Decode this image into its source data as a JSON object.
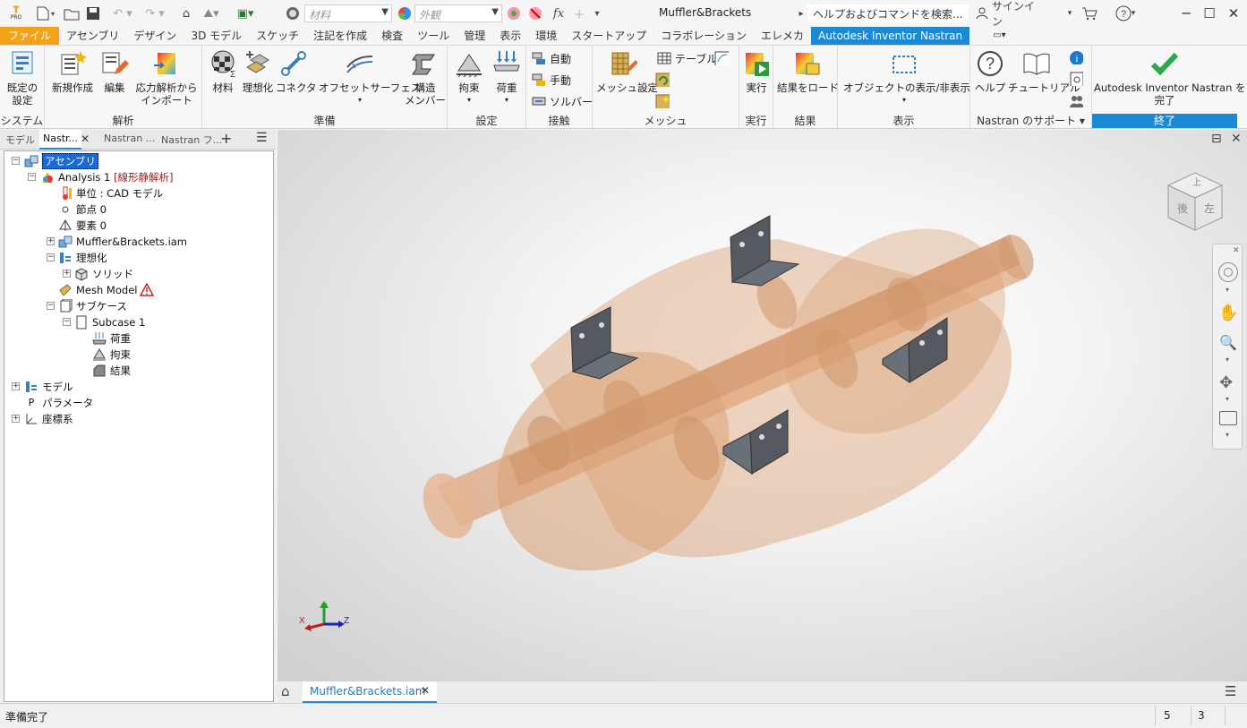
{
  "app": {
    "title": "Muffler&Brackets",
    "logo_text": "PRO"
  },
  "quick_access": {
    "material_placeholder": "材料",
    "appearance_placeholder": "外観",
    "fx_label": "fx"
  },
  "help_search": {
    "placeholder": "ヘルプおよびコマンドを検索..."
  },
  "account": {
    "signin_label": "サインイン"
  },
  "ribbon_tabs": [
    {
      "label": "ファイル"
    },
    {
      "label": "アセンブリ"
    },
    {
      "label": "デザイン"
    },
    {
      "label": "3D モデル"
    },
    {
      "label": "スケッチ"
    },
    {
      "label": "注記を作成"
    },
    {
      "label": "検査"
    },
    {
      "label": "ツール"
    },
    {
      "label": "管理"
    },
    {
      "label": "表示"
    },
    {
      "label": "環境"
    },
    {
      "label": "スタートアップ"
    },
    {
      "label": "コラボレーション"
    },
    {
      "label": "エレメカ"
    },
    {
      "label": "Autodesk Inventor Nastran"
    }
  ],
  "ribbon": {
    "system": {
      "title": "システム",
      "default_settings": "既定の\n設定"
    },
    "analysis": {
      "title": "解析",
      "new": "新規作成",
      "edit": "編集",
      "import": "応力解析から\nインポート"
    },
    "prepare": {
      "title": "準備",
      "material": "材料",
      "idealize": "理想化",
      "connector": "コネクタ",
      "offset": "オフセットサーフェス",
      "structural": "構造\nメンバー"
    },
    "setup": {
      "title": "設定",
      "constraint": "拘束",
      "load": "荷重"
    },
    "contact": {
      "title": "接触",
      "auto": "自動",
      "manual": "手動",
      "solver": "ソルバー"
    },
    "mesh": {
      "title": "メッシュ",
      "settings": "メッシュ設定",
      "table": "テーブル"
    },
    "run": {
      "title": "実行",
      "run": "実行"
    },
    "results": {
      "title": "結果",
      "load_results": "結果をロード"
    },
    "display": {
      "title": "表示",
      "toggle": "オブジェクトの表示/非表示"
    },
    "support": {
      "title": "Nastran のサポート",
      "help": "ヘルプ",
      "tutorial": "チュートリアル"
    },
    "finish": {
      "title": "終了",
      "label": "Autodesk Inventor Nastran を\n完了"
    }
  },
  "browser": {
    "tabs": [
      {
        "label": "モデル"
      },
      {
        "label": "Nastr..."
      },
      {
        "label": "Nastran ..."
      },
      {
        "label": "Nastran フ..."
      }
    ],
    "tree": {
      "assembly": "アセンブリ",
      "analysis": "Analysis 1",
      "analysis_type": "[線形静解析]",
      "units": "単位 : CAD モデル",
      "nodes": "節点 0",
      "elements": "要素 0",
      "assembly_file": "Muffler&Brackets.iam",
      "idealize": "理想化",
      "solid": "ソリッド",
      "mesh_model": "Mesh Model",
      "subcases": "サブケース",
      "subcase1": "Subcase 1",
      "load": "荷重",
      "constraint": "拘束",
      "result": "結果",
      "model": "モデル",
      "parameters": "パラメータ",
      "coord": "座標系"
    }
  },
  "viewcube": {
    "top": "上",
    "back": "後",
    "left": "左"
  },
  "triad": {
    "x": "X",
    "y": "Y",
    "z": "Z"
  },
  "doc_tabs": [
    {
      "label": "Muffler&Brackets.iam"
    }
  ],
  "status": {
    "text": "準備完了",
    "count1": "5",
    "count2": "3"
  },
  "colors": {
    "accent": "#1a8ad6",
    "file_tab": "#f3a21a",
    "model": "#d8874c",
    "bracket": "#555a60"
  }
}
